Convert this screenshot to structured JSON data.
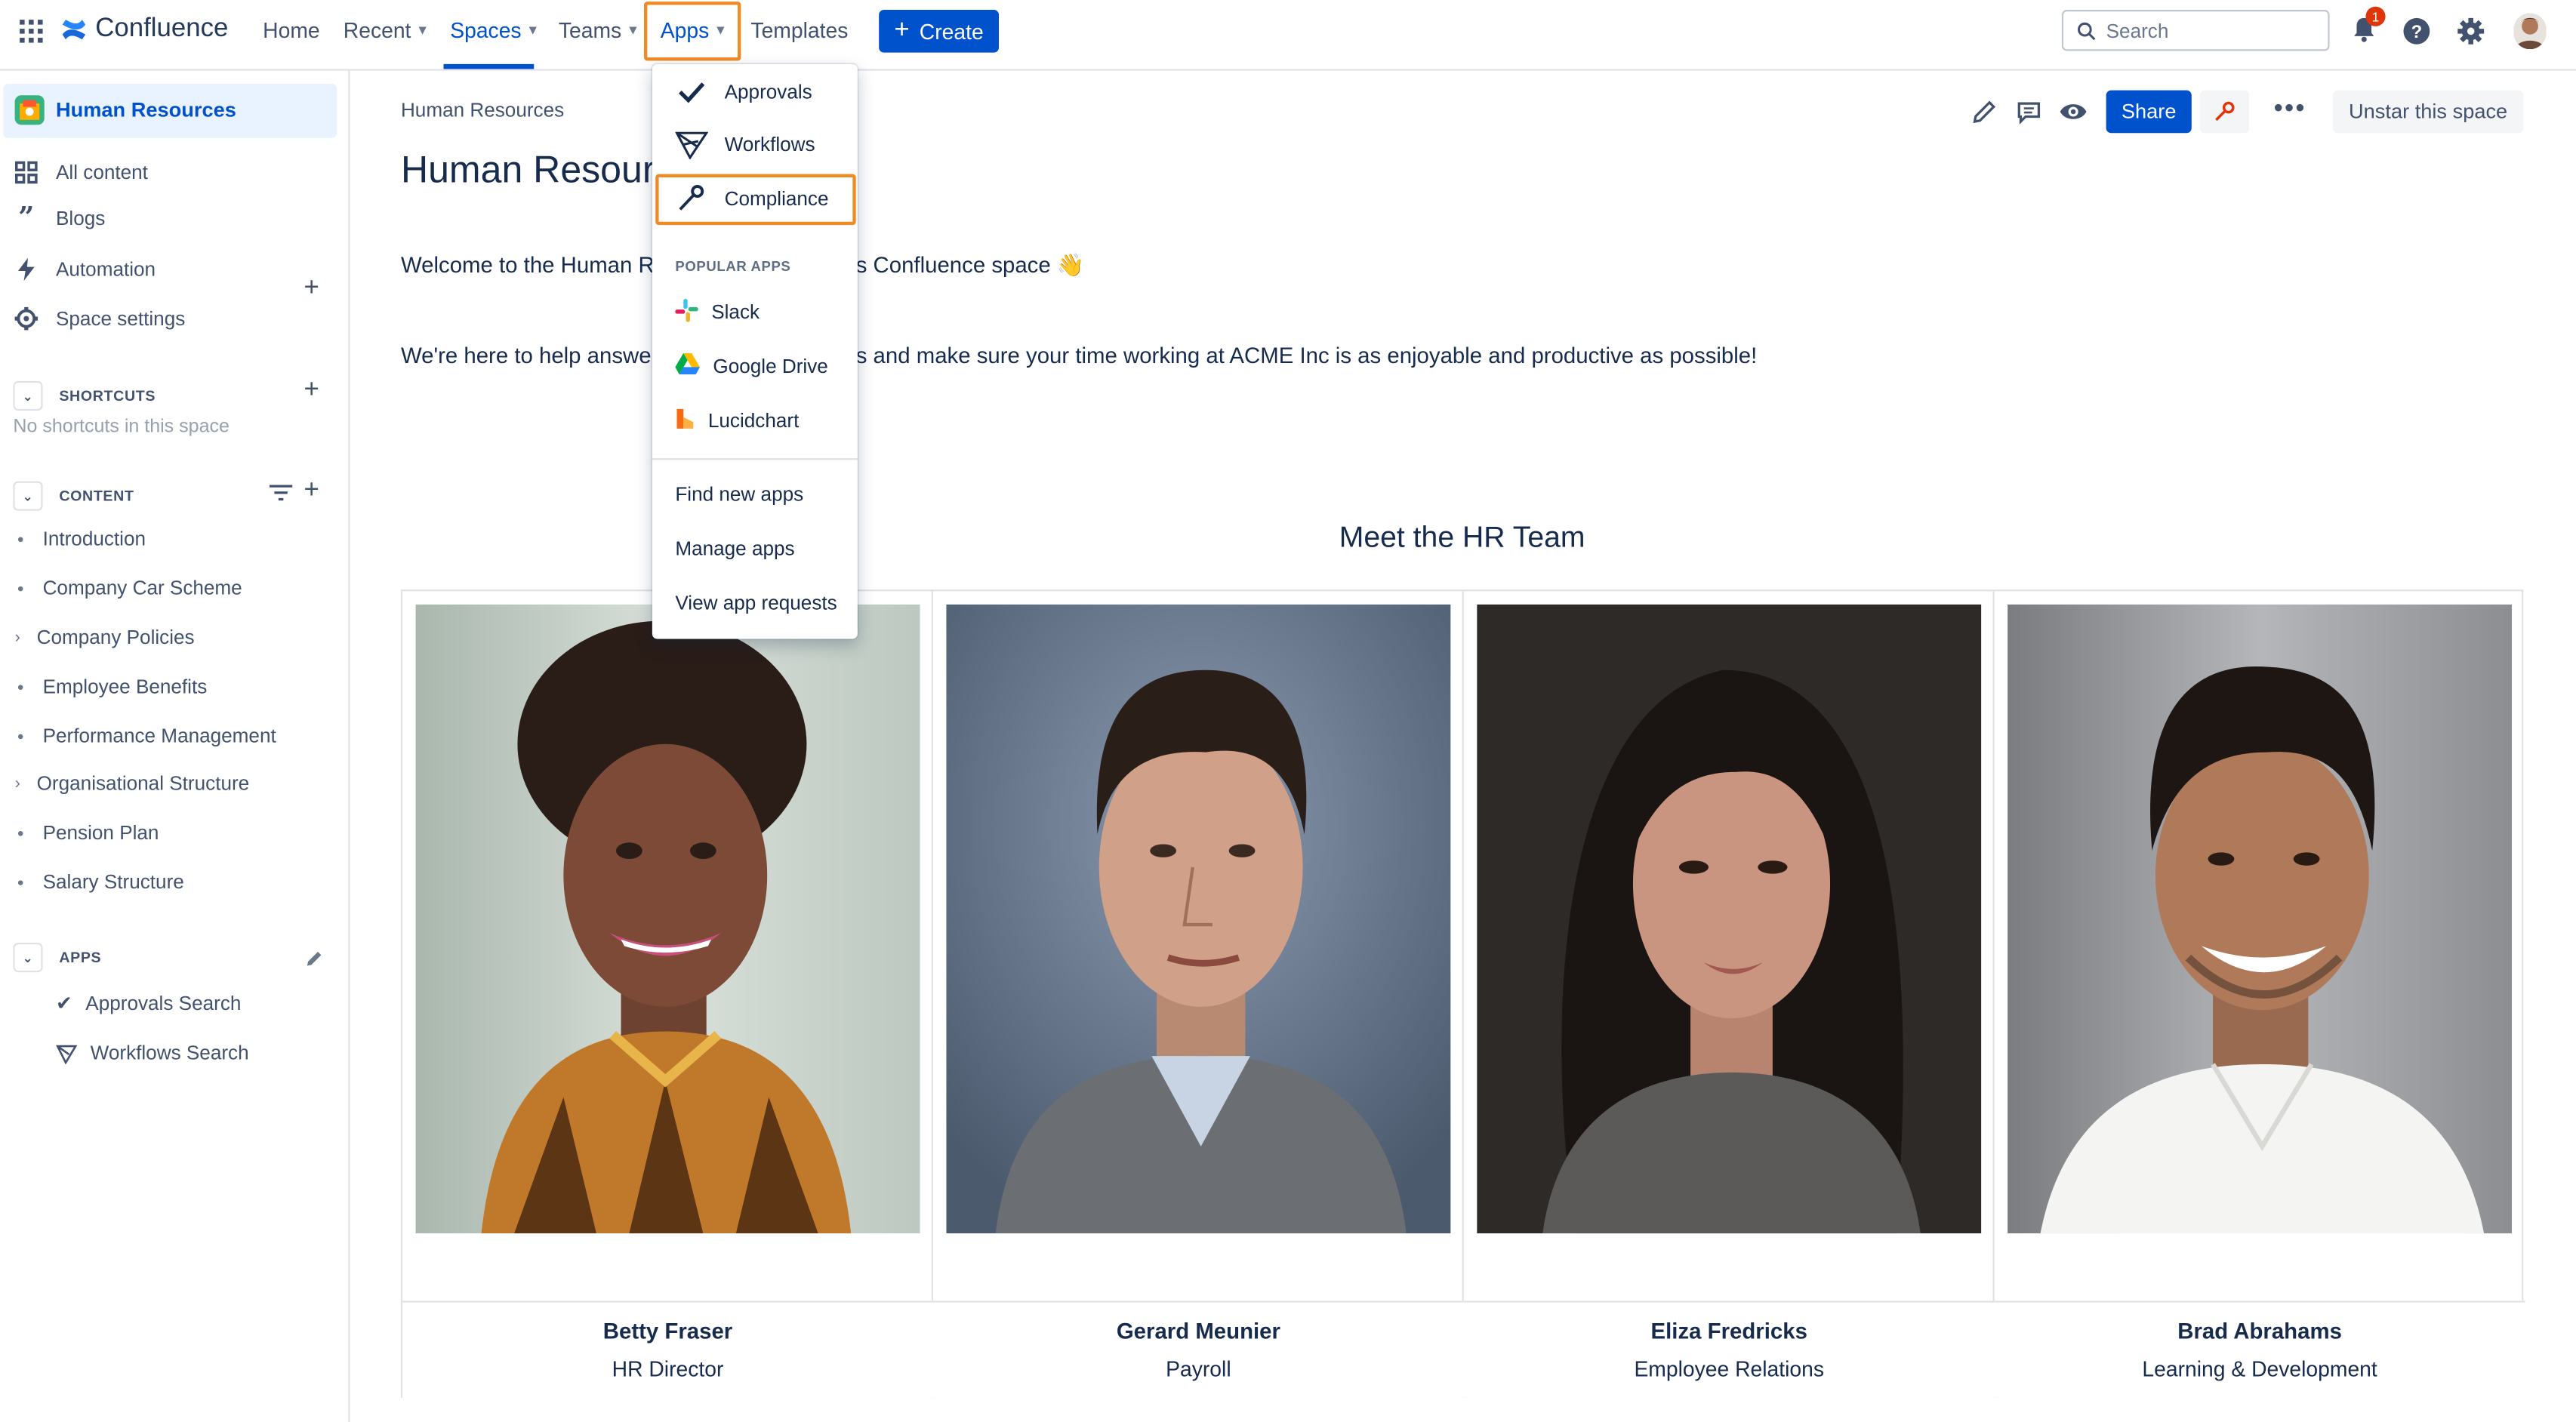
{
  "nav": {
    "brand": "Confluence",
    "home": "Home",
    "recent": "Recent",
    "spaces": "Spaces",
    "teams": "Teams",
    "apps": "Apps",
    "templates": "Templates",
    "create": "Create",
    "search_placeholder": "Search",
    "notification_count": "1"
  },
  "sidebar": {
    "space_name": "Human Resources",
    "items": [
      "All content",
      "Blogs",
      "Automation",
      "Space settings"
    ],
    "shortcuts_heading": "SHORTCUTS",
    "shortcuts_empty": "No shortcuts in this space",
    "content_heading": "CONTENT",
    "tree": [
      {
        "label": "Introduction",
        "expandable": false
      },
      {
        "label": "Company Car Scheme",
        "expandable": false
      },
      {
        "label": "Company Policies",
        "expandable": true
      },
      {
        "label": "Employee Benefits",
        "expandable": false
      },
      {
        "label": "Performance Management",
        "expandable": false
      },
      {
        "label": "Organisational Structure",
        "expandable": true
      },
      {
        "label": "Pension Plan",
        "expandable": false
      },
      {
        "label": "Salary Structure",
        "expandable": false
      }
    ],
    "apps_heading": "APPS",
    "apps": [
      "Approvals Search",
      "Workflows Search"
    ]
  },
  "page": {
    "breadcrumb": "Human Resources",
    "title": "Human Resourc",
    "welcome_a": "Welcome to the Human Re",
    "welcome_b": "s Confluence space 👋",
    "help_a": "We're here to help answer",
    "help_b": "s and make sure your time working at ACME Inc is as enjoyable and productive as possible!",
    "share": "Share",
    "unstar": "Unstar this space",
    "team_heading": "Meet the HR Team",
    "team": [
      {
        "name": "Betty Fraser",
        "role": "HR Director"
      },
      {
        "name": "Gerard Meunier",
        "role": "Payroll"
      },
      {
        "name": "Eliza Fredricks",
        "role": "Employee Relations"
      },
      {
        "name": "Brad Abrahams",
        "role": "Learning & Development"
      }
    ]
  },
  "apps_menu": {
    "items": [
      "Approvals",
      "Workflows",
      "Compliance"
    ],
    "popular_heading": "POPULAR APPS",
    "popular": [
      "Slack",
      "Google Drive",
      "Lucidchart"
    ],
    "footer": [
      "Find new apps",
      "Manage apps",
      "View app requests"
    ]
  },
  "colors": {
    "accent": "#0052cc",
    "highlight": "#f08a24",
    "text": "#172b4d"
  }
}
